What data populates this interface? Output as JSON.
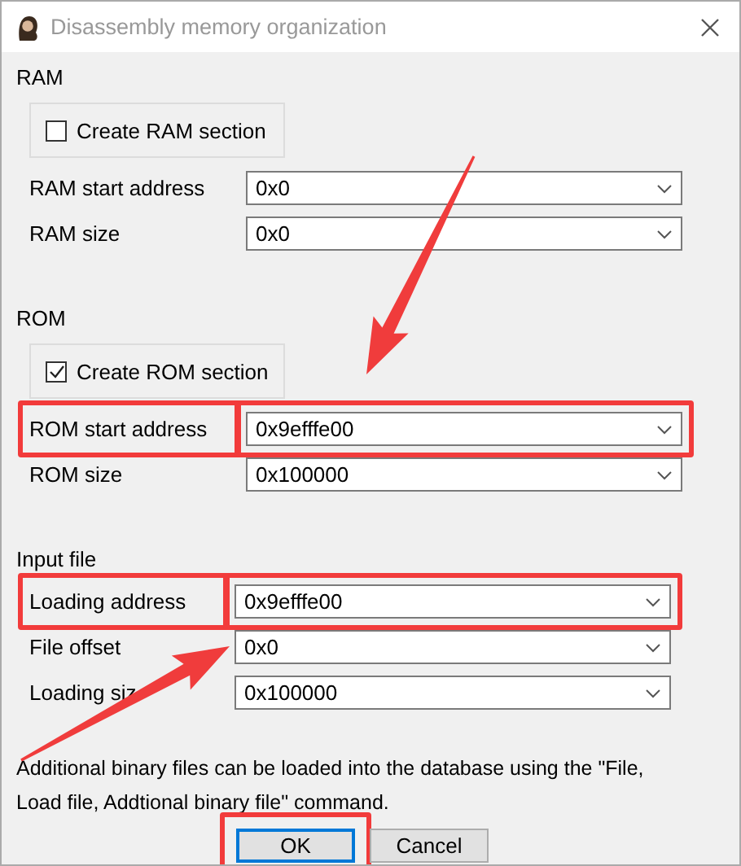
{
  "window": {
    "title": "Disassembly memory organization"
  },
  "sections": [
    {
      "kind": "memory",
      "title": "RAM",
      "checkbox": {
        "label": "Create RAM section",
        "checked": false
      },
      "fields": [
        {
          "label": "RAM start address",
          "value": "0x0",
          "highlighted": false
        },
        {
          "label": "RAM size",
          "value": "0x0",
          "highlighted": false
        }
      ]
    },
    {
      "kind": "memory",
      "title": "ROM",
      "checkbox": {
        "label": "Create ROM section",
        "checked": true
      },
      "fields": [
        {
          "label": "ROM start address",
          "value": "0x9efffe00",
          "highlighted": true
        },
        {
          "label": "ROM size",
          "value": "0x100000",
          "highlighted": false
        }
      ]
    },
    {
      "kind": "file",
      "title": "Input file",
      "fields": [
        {
          "label": "Loading address",
          "value": "0x9efffe00",
          "highlighted": true
        },
        {
          "label": "File offset",
          "value": "0x0",
          "highlighted": false
        },
        {
          "label": "Loading siz",
          "value": "0x100000",
          "highlighted": false
        }
      ]
    }
  ],
  "note": "Additional binary files can be loaded into the database using the \"File, Load file, Addtional binary file\" command.",
  "buttons": [
    {
      "label": "OK",
      "default": true,
      "highlighted": true
    },
    {
      "label": "Cancel",
      "default": false,
      "highlighted": false
    }
  ]
}
